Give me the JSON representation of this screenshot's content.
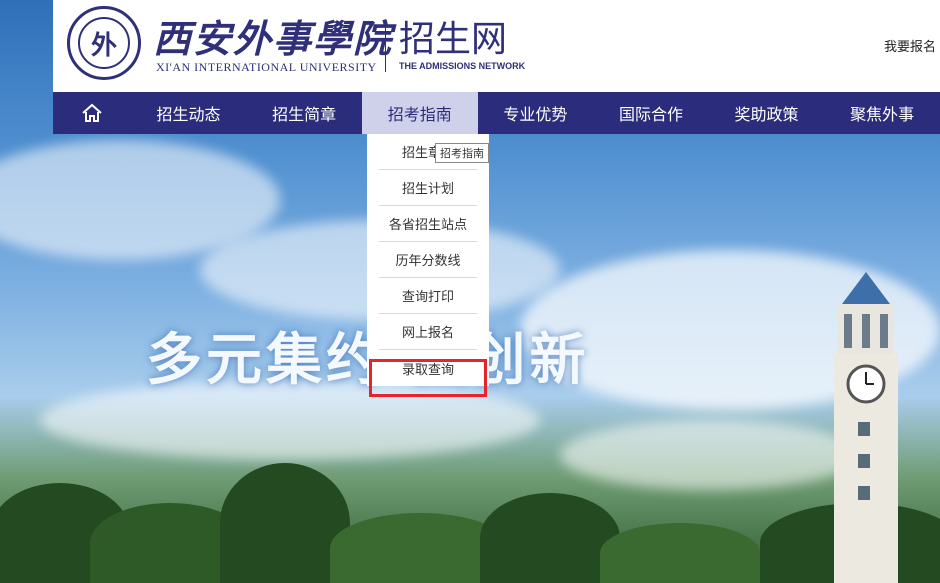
{
  "header": {
    "logo_cn": "西安外事學院",
    "logo_en": "XI'AN INTERNATIONAL UNIVERSITY",
    "site_title": "招生网",
    "site_subtitle": "THE ADMISSIONS NETWORK",
    "apply_link": "我要报名"
  },
  "nav": {
    "items": [
      {
        "label": "招生动态"
      },
      {
        "label": "招生简章"
      },
      {
        "label": "招考指南"
      },
      {
        "label": "专业优势"
      },
      {
        "label": "国际合作"
      },
      {
        "label": "奖助政策"
      },
      {
        "label": "聚焦外事"
      }
    ],
    "active_index": 2
  },
  "dropdown": {
    "items": [
      {
        "label": "招生章程"
      },
      {
        "label": "招生计划"
      },
      {
        "label": "各省招生站点"
      },
      {
        "label": "历年分数线"
      },
      {
        "label": "查询打印"
      },
      {
        "label": "网上报名"
      },
      {
        "label": "录取查询"
      }
    ],
    "highlighted_index": 6
  },
  "tooltip": "招考指南",
  "banner": {
    "slogan": "多元集约 强创新"
  },
  "colors": {
    "brand": "#2c2c7c",
    "active_nav_bg": "#cfd0ea",
    "highlight_border": "#e8232a"
  }
}
